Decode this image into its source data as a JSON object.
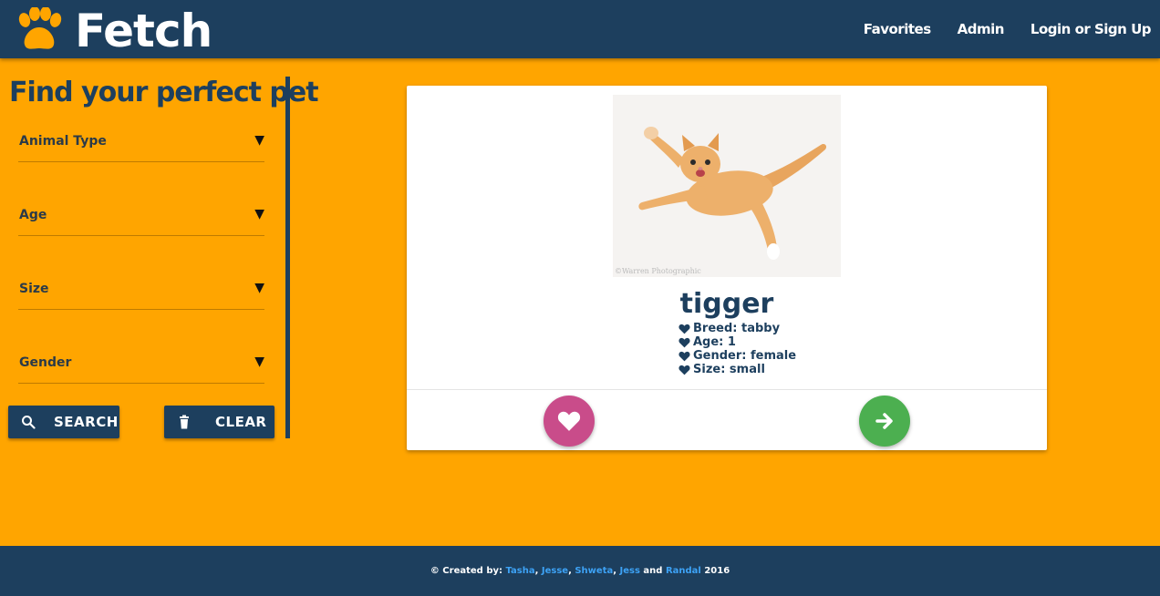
{
  "colors": {
    "navy": "#1D3F5E",
    "orange": "#FFA500",
    "favorite_pink": "#C94C8A",
    "next_green": "#4CAF50",
    "link_blue": "#3DA2F5"
  },
  "header": {
    "brand": "Fetch",
    "logo_icon": "paw-icon",
    "nav": [
      {
        "label": "Favorites"
      },
      {
        "label": "Admin"
      },
      {
        "label": "Login or Sign Up"
      }
    ]
  },
  "sidebar": {
    "title": "Find your perfect pet",
    "selects": [
      {
        "label": "Animal Type"
      },
      {
        "label": "Age"
      },
      {
        "label": "Size"
      },
      {
        "label": "Gender"
      }
    ],
    "caret": "▼",
    "search_label": "SEARCH",
    "search_icon": "search-icon",
    "clear_label": "CLEAR",
    "clear_icon": "trash-icon"
  },
  "card": {
    "photo_alt": "orange tabby kitten",
    "watermark": "©Warren Photographic",
    "name": "tigger",
    "details": [
      {
        "text": "Breed: tabby"
      },
      {
        "text": "Age: 1"
      },
      {
        "text": "Gender: female"
      },
      {
        "text": "Size: small"
      }
    ],
    "favorite_icon": "heart-icon",
    "next_icon": "arrow-right-icon"
  },
  "footer": {
    "prefix": "© Created by: ",
    "authors": [
      "Tasha",
      "Jesse",
      "Shweta",
      "Jess",
      "Randal"
    ],
    "sep": ", ",
    "and": " and ",
    "year": " 2016"
  }
}
